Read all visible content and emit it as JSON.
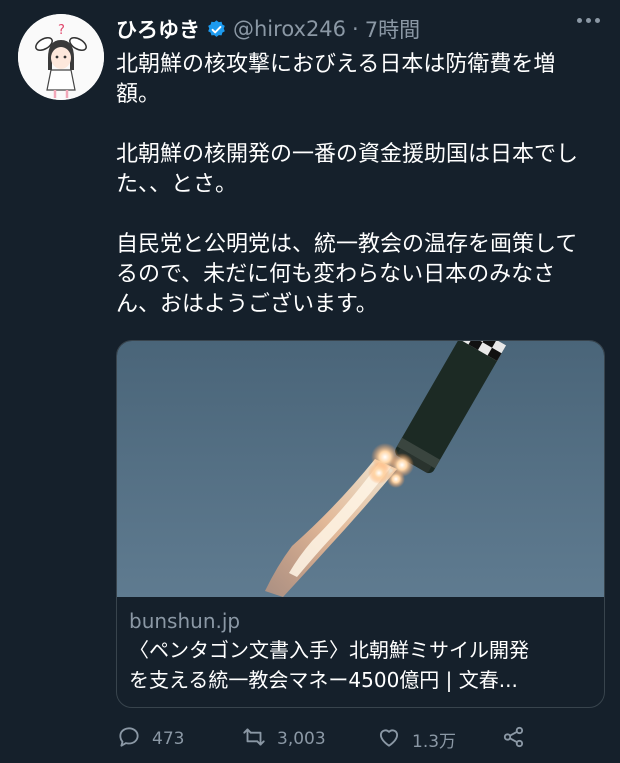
{
  "user": {
    "display_name": "ひろゆき",
    "handle": "@hirox246",
    "separator": "·",
    "time": "7時間"
  },
  "tweet": {
    "paragraphs": [
      [
        "北朝鮮の核攻撃におびえる日本は防衛費を増",
        "額。"
      ],
      [
        "北朝鮮の核開発の一番の資金援助国は日本でし",
        "た、、とさ。"
      ],
      [
        "自民党と公明党は、統一教会の温存を画策して",
        "るので、未だに何も変わらない日本のみなさ",
        "ん、おはようございます。"
      ]
    ]
  },
  "card": {
    "domain": "bunshun.jp",
    "title_line1": "〈ペンタゴン文書入手〉北朝鮮ミサイル開発",
    "title_line2": "を支える統一教会マネー4500億円 | 文春..."
  },
  "actions": {
    "replies": "473",
    "retweets": "3,003",
    "likes": "1.3万"
  },
  "colors": {
    "background": "#15202b",
    "secondary_text": "#8b98a5",
    "verified": "#1d9bf0",
    "border": "#38444d"
  },
  "icons": [
    "more-icon",
    "verified-icon",
    "reply-icon",
    "retweet-icon",
    "like-icon",
    "share-icon"
  ]
}
